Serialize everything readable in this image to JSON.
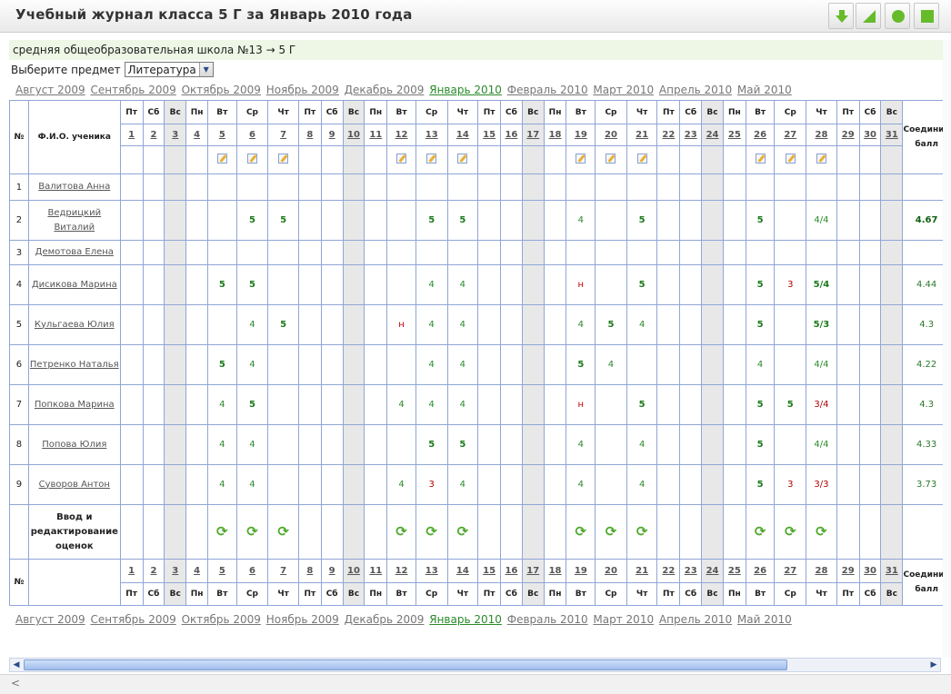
{
  "window": {
    "title": "Учебный журнал класса 5 Г за Январь 2010 года"
  },
  "toolbar": {
    "buttons": [
      "down-arrow-icon",
      "resize-icon",
      "circle-icon",
      "square-icon"
    ],
    "accent": "#66bb2a"
  },
  "school_line": "средняя общеобразовательная школа №13 → 5 Г",
  "subject": {
    "label": "Выберите предмет",
    "selected": "Литература"
  },
  "months": [
    "Август 2009",
    "Сентябрь 2009",
    "Октябрь 2009",
    "Ноябрь 2009",
    "Декабрь 2009",
    "Январь 2010",
    "Февраль 2010",
    "Март 2010",
    "Апрель 2010",
    "Май 2010"
  ],
  "active_month": "Январь 2010",
  "table": {
    "num_header": "№",
    "name_header": "Ф.И.О. ученика",
    "avg_header": "Соединий балл",
    "edit_label": "Ввод и редактирование оценок",
    "days": [
      {
        "n": "1",
        "w": "Пт"
      },
      {
        "n": "2",
        "w": "Сб"
      },
      {
        "n": "3",
        "w": "Вс"
      },
      {
        "n": "4",
        "w": "Пн"
      },
      {
        "n": "5",
        "w": "Вт"
      },
      {
        "n": "6",
        "w": "Ср"
      },
      {
        "n": "7",
        "w": "Чт"
      },
      {
        "n": "8",
        "w": "Пт"
      },
      {
        "n": "9",
        "w": "Сб"
      },
      {
        "n": "10",
        "w": "Вс"
      },
      {
        "n": "11",
        "w": "Пн"
      },
      {
        "n": "12",
        "w": "Вт"
      },
      {
        "n": "13",
        "w": "Ср"
      },
      {
        "n": "14",
        "w": "Чт"
      },
      {
        "n": "15",
        "w": "Пт"
      },
      {
        "n": "16",
        "w": "Сб"
      },
      {
        "n": "17",
        "w": "Вс"
      },
      {
        "n": "18",
        "w": "Пн"
      },
      {
        "n": "19",
        "w": "Вт"
      },
      {
        "n": "20",
        "w": "Ср"
      },
      {
        "n": "21",
        "w": "Чт"
      },
      {
        "n": "22",
        "w": "Пт"
      },
      {
        "n": "23",
        "w": "Сб"
      },
      {
        "n": "24",
        "w": "Вс"
      },
      {
        "n": "25",
        "w": "Пн"
      },
      {
        "n": "26",
        "w": "Вт"
      },
      {
        "n": "27",
        "w": "Ср"
      },
      {
        "n": "28",
        "w": "Чт"
      },
      {
        "n": "29",
        "w": "Пт"
      },
      {
        "n": "30",
        "w": "Сб"
      },
      {
        "n": "31",
        "w": "Вс"
      }
    ],
    "weekends": [
      3,
      10,
      17,
      24,
      31
    ],
    "lesson_days": [
      5,
      6,
      7,
      12,
      13,
      14,
      19,
      20,
      21,
      26,
      27,
      28
    ],
    "students": [
      {
        "num": "1",
        "name": "Валитова Анна",
        "grades": {},
        "avg": ""
      },
      {
        "num": "2",
        "name": "Ведрицкий Виталий",
        "grades": {
          "6": "5",
          "7": "5",
          "13": "5",
          "14": "5",
          "19": "4",
          "21": "5",
          "26": "5",
          "28": "4/4"
        },
        "avg": "4.67"
      },
      {
        "num": "3",
        "name": "Демотова Елена",
        "grades": {},
        "avg": ""
      },
      {
        "num": "4",
        "name": "Дисикова Марина",
        "grades": {
          "5": "5",
          "6": "5",
          "13": "4",
          "14": "4",
          "19": "н",
          "21": "5",
          "26": "5",
          "27": "3",
          "28": "5/4"
        },
        "avg": "4.44"
      },
      {
        "num": "5",
        "name": "Кульгаева Юлия",
        "grades": {
          "6": "4",
          "7": "5",
          "12": "н",
          "13": "4",
          "14": "4",
          "19": "4",
          "20": "5",
          "21": "4",
          "26": "5",
          "28": "5/3"
        },
        "avg": "4.3"
      },
      {
        "num": "6",
        "name": "Петренко Наталья",
        "grades": {
          "5": "5",
          "6": "4",
          "13": "4",
          "14": "4",
          "19": "5",
          "20": "4",
          "26": "4",
          "28": "4/4"
        },
        "avg": "4.22"
      },
      {
        "num": "7",
        "name": "Попкова Марина",
        "grades": {
          "5": "4",
          "6": "5",
          "12": "4",
          "13": "4",
          "14": "4",
          "19": "н",
          "21": "5",
          "26": "5",
          "27": "5",
          "28": "3/4"
        },
        "avg": "4.3"
      },
      {
        "num": "8",
        "name": "Попова Юлия",
        "grades": {
          "5": "4",
          "6": "4",
          "13": "5",
          "14": "5",
          "19": "4",
          "21": "4",
          "26": "5",
          "28": "4/4"
        },
        "avg": "4.33"
      },
      {
        "num": "9",
        "name": "Суворов Антон",
        "grades": {
          "5": "4",
          "6": "4",
          "12": "4",
          "13": "3",
          "14": "4",
          "19": "4",
          "21": "4",
          "26": "5",
          "27": "3",
          "28": "3/3"
        },
        "avg": "3.73"
      }
    ]
  },
  "statusbar": {
    "text": "<"
  }
}
